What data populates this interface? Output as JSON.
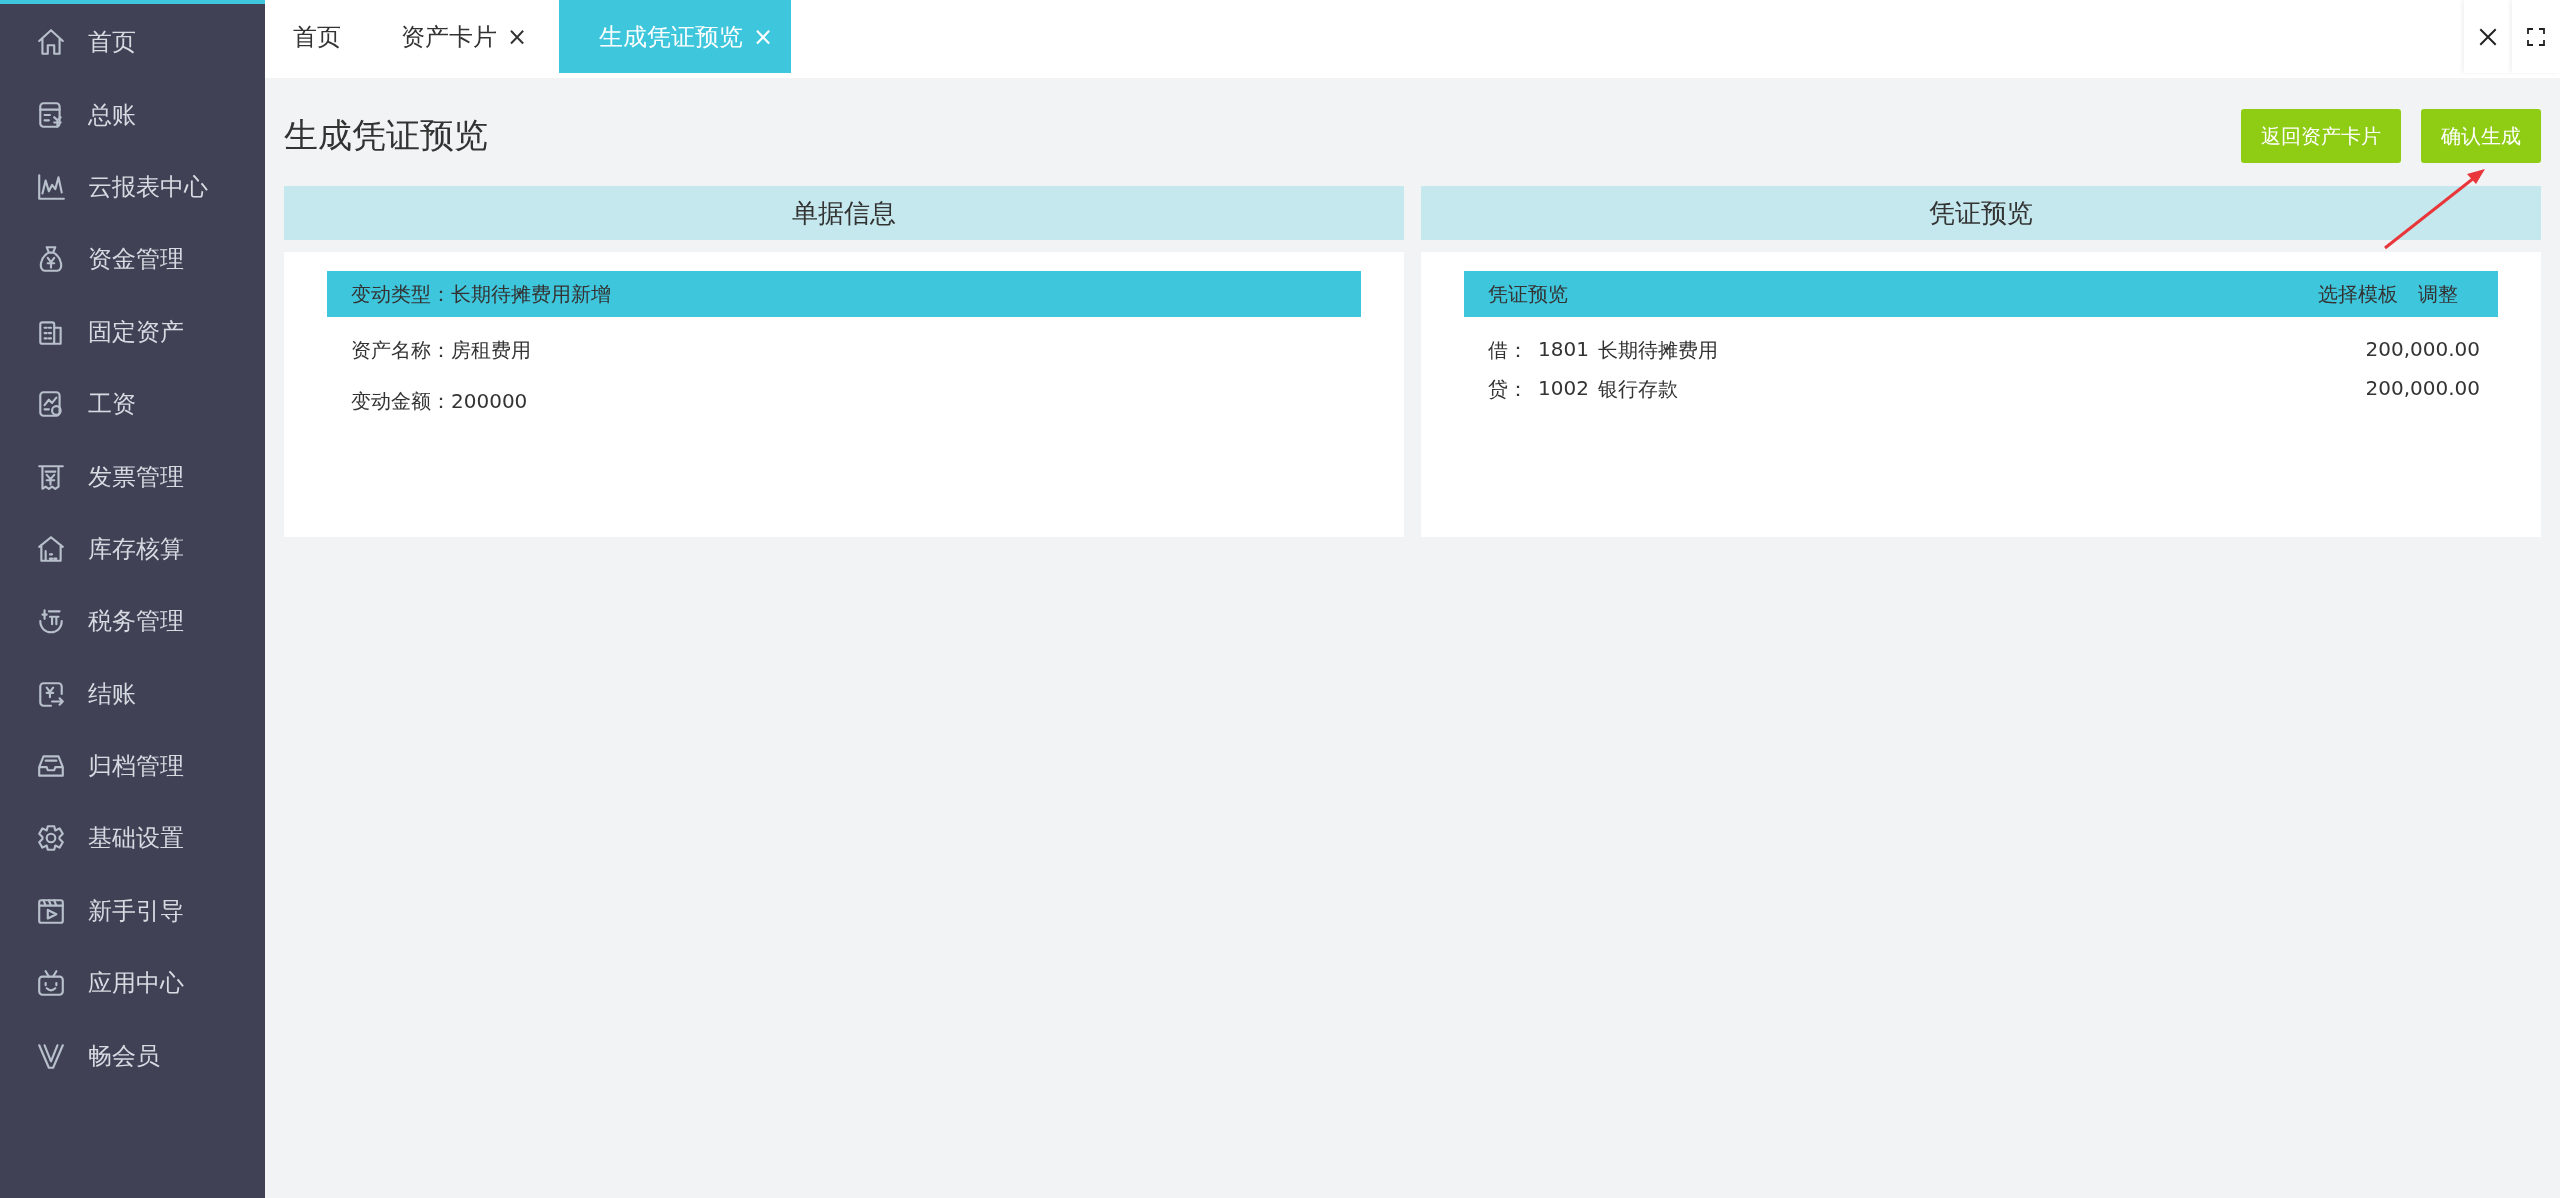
{
  "sidebar": {
    "items": [
      {
        "label": "首页"
      },
      {
        "label": "总账"
      },
      {
        "label": "云报表中心"
      },
      {
        "label": "资金管理"
      },
      {
        "label": "固定资产"
      },
      {
        "label": "工资"
      },
      {
        "label": "发票管理"
      },
      {
        "label": "库存核算"
      },
      {
        "label": "税务管理"
      },
      {
        "label": "结账"
      },
      {
        "label": "归档管理"
      },
      {
        "label": "基础设置"
      },
      {
        "label": "新手引导"
      },
      {
        "label": "应用中心"
      },
      {
        "label": "畅会员"
      }
    ]
  },
  "tabs": [
    {
      "label": "首页",
      "selected": false
    },
    {
      "label": "资产卡片",
      "close": "×",
      "selected": false
    },
    {
      "label": "生成凭证预览",
      "close": "×",
      "selected": true
    }
  ],
  "page_title": "生成凭证预览",
  "buttons": [
    "返回资产卡片",
    "确认生成"
  ],
  "document_panel": {
    "header": "单据信息",
    "bar_text": "变动类型：长期待摊费用新增",
    "fields": [
      "资产名称：房租费用",
      "变动金额：200000"
    ]
  },
  "voucher_panel": {
    "header": "凭证预览",
    "bar_title": "凭证预览",
    "actions": [
      "选择模板",
      "调整"
    ],
    "entries": [
      {
        "direction": "借：",
        "code": "1801",
        "account": "长期待摊费用",
        "amount": "200,000.00"
      },
      {
        "direction": "贷：",
        "code": "1002",
        "account": "银行存款",
        "amount": "200,000.00"
      }
    ]
  }
}
